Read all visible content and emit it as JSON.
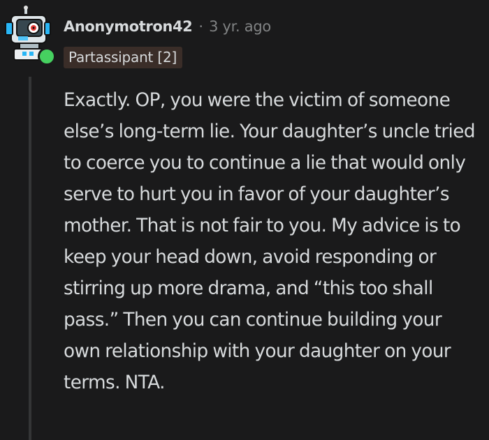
{
  "comment": {
    "author": "Anonymotron42",
    "separator": "·",
    "timestamp": "3 yr. ago",
    "flair": "Partassipant [2]",
    "avatar_icon": "robot-avatar-icon",
    "online_status_color": "#46d160",
    "body": "Exactly. OP, you were the victim of someone else’s long-term lie. Your daughter’s uncle tried to coerce you to continue a lie that would only serve to hurt you in favor of your daughter’s mother. That is not fair to you. My advice is to keep your head down, avoid responding or stirring up more drama, and “this too shall pass.” Then you can continue building your own relationship with your daughter on your terms. NTA."
  },
  "colors": {
    "background": "#1a1a1b",
    "text": "#d7dadc",
    "meta_text": "#818384",
    "flair_background": "#3a2d28",
    "thread_line": "#343536"
  }
}
